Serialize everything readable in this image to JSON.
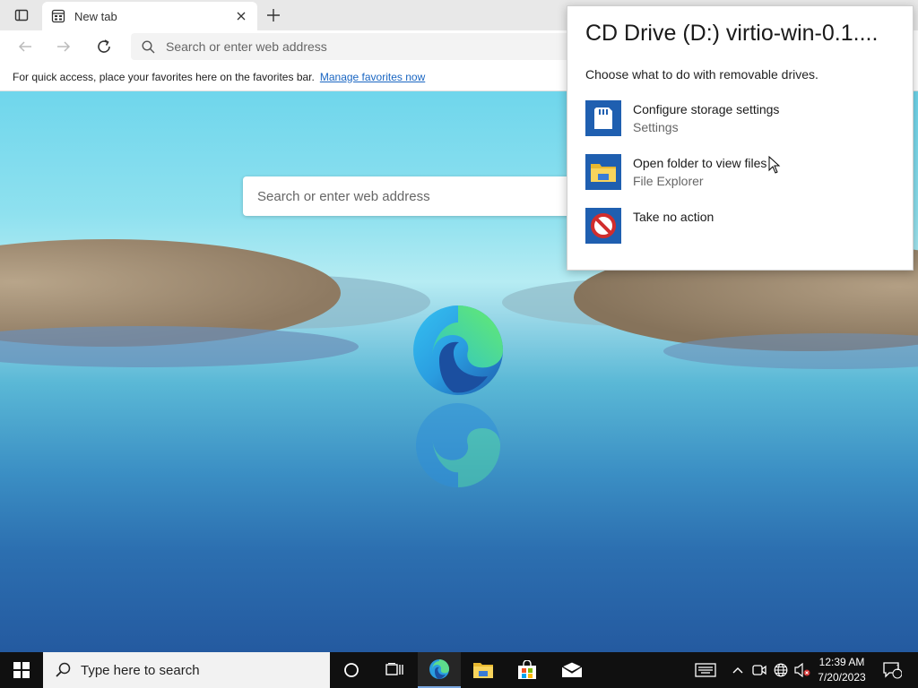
{
  "browser": {
    "tab": {
      "title": "New tab"
    },
    "address_bar": {
      "placeholder": "Search or enter web address"
    },
    "favorites_bar": {
      "message": "For quick access, place your favorites here on the favorites bar.",
      "link": "Manage favorites now"
    }
  },
  "page": {
    "search_placeholder": "Search or enter web address"
  },
  "autoplay": {
    "title": "CD Drive (D:) virtio-win-0.1....",
    "subtitle": "Choose what to do with removable drives.",
    "options": [
      {
        "label": "Configure storage settings",
        "sub": "Settings",
        "icon": "sd-card-icon"
      },
      {
        "label": "Open folder to view files",
        "sub": "File Explorer",
        "icon": "folder-icon"
      },
      {
        "label": "Take no action",
        "sub": "",
        "icon": "no-action-icon"
      }
    ]
  },
  "taskbar": {
    "search_placeholder": "Type here to search",
    "time": "12:39 AM",
    "date": "7/20/2023",
    "notification_count": "1"
  },
  "colors": {
    "accent": "#1f5fb0",
    "link": "#1a66c2",
    "taskbar": "#101010"
  }
}
